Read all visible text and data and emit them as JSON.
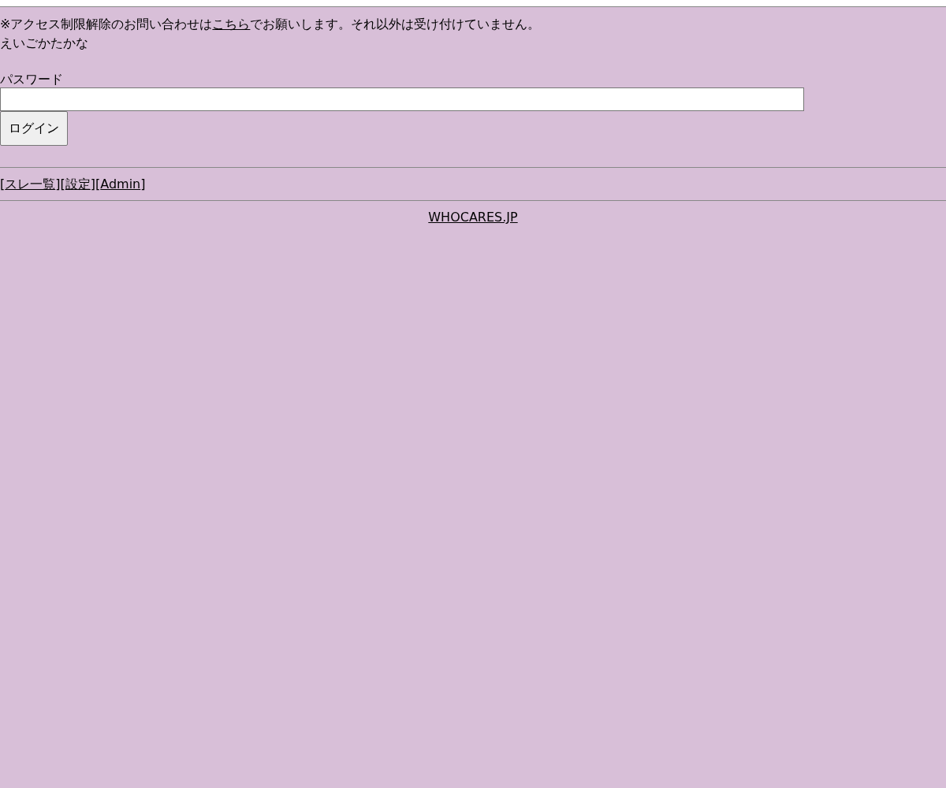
{
  "notice": {
    "before": "※アクセス制限解除のお問い合わせは",
    "link": "こちら",
    "after": "でお願いします。それ以外は受け付けていません。"
  },
  "subtext": "えいごかたかな",
  "password": {
    "label": "パスワード"
  },
  "login_button": "ログイン",
  "nav": [
    {
      "open": "[",
      "label": "スレ一覧",
      "close": "]"
    },
    {
      "open": "[",
      "label": "設定",
      "close": "]"
    },
    {
      "open": "[",
      "label": "Admin",
      "close": "]"
    }
  ],
  "footer": {
    "link": "WHOCARES.JP"
  }
}
